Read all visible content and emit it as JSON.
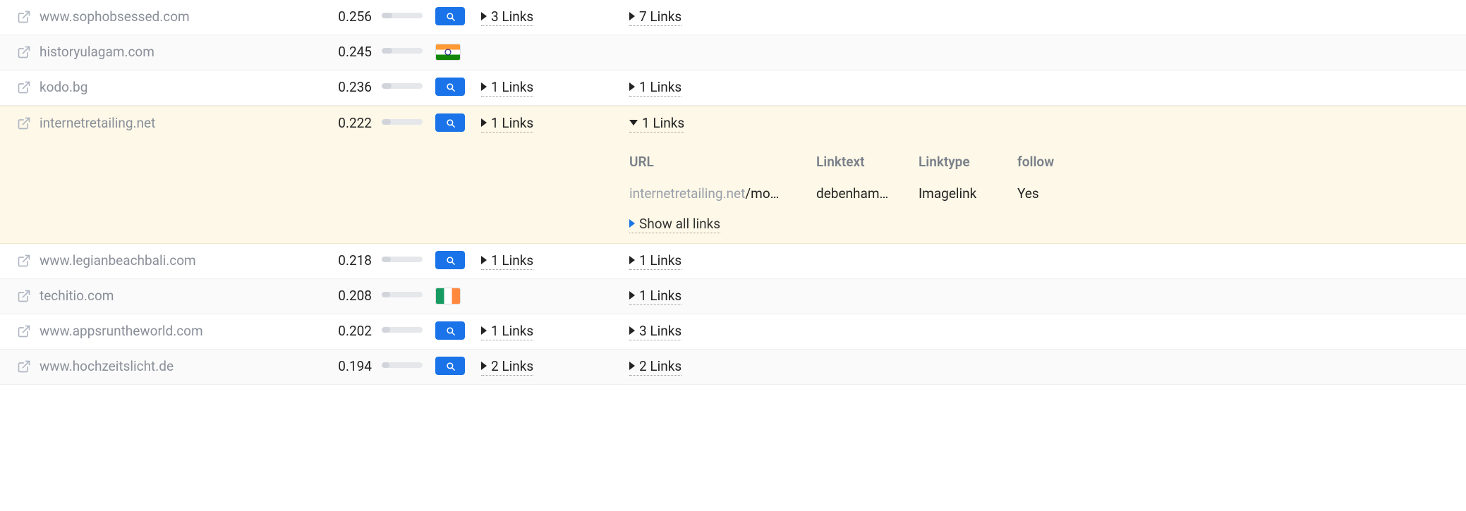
{
  "strings": {
    "links_suffix": " Links",
    "show_all": "Show all links"
  },
  "headers": {
    "url": "URL",
    "linktext": "Linktext",
    "linktype": "Linktype",
    "follow": "follow"
  },
  "rows": [
    {
      "domain": "www.sophobsessed.com",
      "score": "0.256",
      "bar_pct": 26,
      "badge": "search",
      "links1": "3",
      "links2": "7",
      "alt": false,
      "expanded": false
    },
    {
      "domain": "historyulagam.com",
      "score": "0.245",
      "bar_pct": 25,
      "badge": "flag-in",
      "links1": null,
      "links2": null,
      "alt": true,
      "expanded": false
    },
    {
      "domain": "kodo.bg",
      "score": "0.236",
      "bar_pct": 24,
      "badge": "search",
      "links1": "1",
      "links2": "1",
      "alt": false,
      "expanded": false
    },
    {
      "domain": "internetretailing.net",
      "score": "0.222",
      "bar_pct": 22,
      "badge": "search",
      "links1": "1",
      "links2": "1",
      "alt": false,
      "expanded": true,
      "detail": {
        "url_host": "internetretailing.net",
        "url_path": "/mo…",
        "linktext": "debenham…",
        "linktype": "Imagelink",
        "follow": "Yes"
      }
    },
    {
      "domain": "www.legianbeachbali.com",
      "score": "0.218",
      "bar_pct": 22,
      "badge": "search",
      "links1": "1",
      "links2": "1",
      "alt": false,
      "expanded": false
    },
    {
      "domain": "techitio.com",
      "score": "0.208",
      "bar_pct": 21,
      "badge": "flag-ie",
      "links1": null,
      "links2": "1",
      "alt": true,
      "expanded": false
    },
    {
      "domain": "www.appsruntheworld.com",
      "score": "0.202",
      "bar_pct": 20,
      "badge": "search",
      "links1": "1",
      "links2": "3",
      "alt": false,
      "expanded": false
    },
    {
      "domain": "www.hochzeitslicht.de",
      "score": "0.194",
      "bar_pct": 19,
      "badge": "search",
      "links1": "2",
      "links2": "2",
      "alt": true,
      "expanded": false
    }
  ]
}
